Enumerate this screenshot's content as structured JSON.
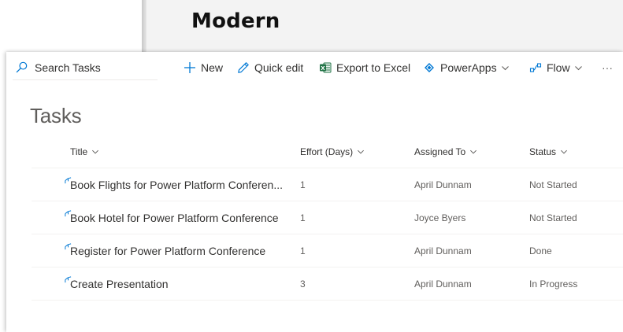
{
  "page": {
    "heading": "Modern"
  },
  "commandbar": {
    "search_placeholder": "Search Tasks",
    "new_label": "New",
    "quick_edit_label": "Quick edit",
    "export_label": "Export to Excel",
    "powerapps_label": "PowerApps",
    "flow_label": "Flow",
    "more_label": "···"
  },
  "list": {
    "title": "Tasks",
    "columns": [
      "Title",
      "Effort (Days)",
      "Assigned To",
      "Status"
    ],
    "rows": [
      {
        "title": "Book Flights for Power Platform Conferen...",
        "effort": "1",
        "assigned": "April Dunnam",
        "status": "Not Started"
      },
      {
        "title": "Book Hotel for Power Platform Conference",
        "effort": "1",
        "assigned": "Joyce Byers",
        "status": "Not Started"
      },
      {
        "title": "Register for Power Platform Conference",
        "effort": "1",
        "assigned": "April Dunnam",
        "status": "Done"
      },
      {
        "title": "Create Presentation",
        "effort": "3",
        "assigned": "April Dunnam",
        "status": "In Progress"
      }
    ]
  },
  "colors": {
    "accent": "#0078d4",
    "excel_green": "#217346",
    "powerapps": "#742774",
    "text": "#323130",
    "subtle_text": "#605e5c"
  },
  "icons": [
    "search-icon",
    "add-icon",
    "pencil-icon",
    "excel-icon",
    "powerapps-icon",
    "flow-icon",
    "chevron-down-icon",
    "more-icon",
    "new-item-icon"
  ]
}
